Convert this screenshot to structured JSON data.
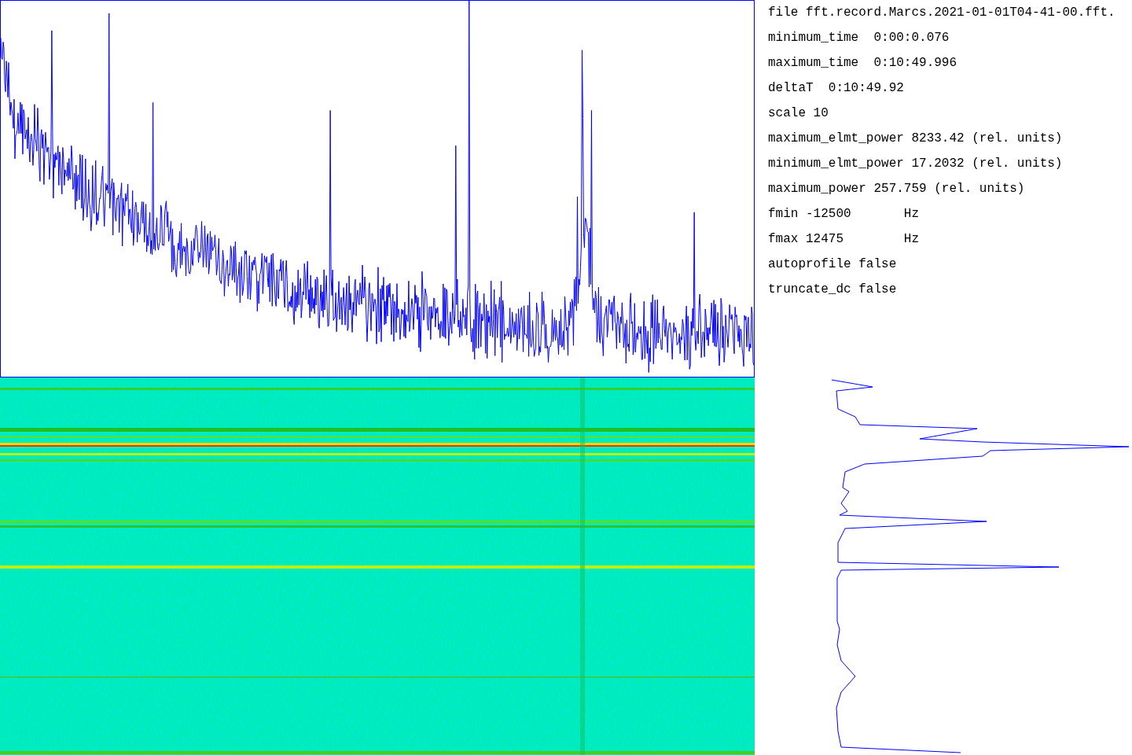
{
  "info_lines": [
    {
      "text": "file fft.record.Marcs.2021-01-01T04-41-00.fft."
    },
    {
      "text": "minimum_time  0:00:0.076"
    },
    {
      "text": "maximum_time  0:10:49.996"
    },
    {
      "text": "deltaT  0:10:49.92"
    },
    {
      "text": "scale 10"
    },
    {
      "text": "maximum_elmt_power 8233.42 (rel. units)"
    },
    {
      "text": "minimum_elmt_power 17.2032 (rel. units)"
    },
    {
      "text": "maximum_power 257.759 (rel. units)"
    },
    {
      "text": "fmin -12500       Hz"
    },
    {
      "text": "fmax 12475        Hz"
    },
    {
      "text": "autoprofile false"
    },
    {
      "text": "truncate_dc false"
    }
  ]
}
